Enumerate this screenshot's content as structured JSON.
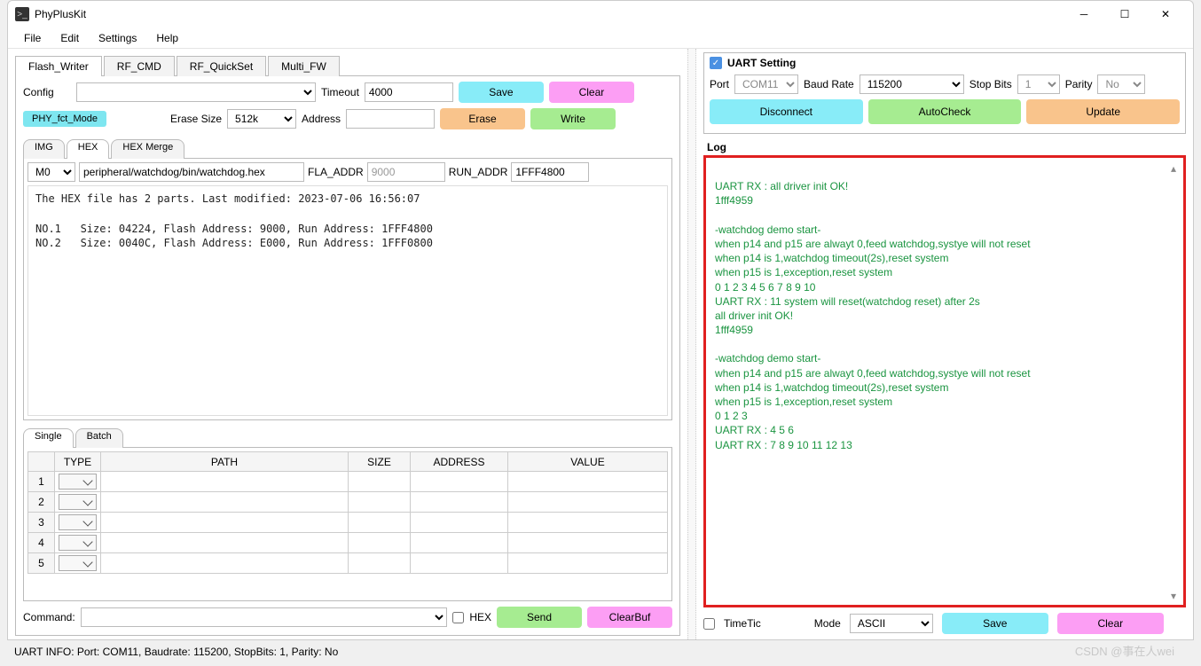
{
  "title": "PhyPlusKit",
  "menu": {
    "file": "File",
    "edit": "Edit",
    "settings": "Settings",
    "help": "Help"
  },
  "mainTabs": {
    "flash": "Flash_Writer",
    "rf": "RF_CMD",
    "rfq": "RF_QuickSet",
    "multi": "Multi_FW"
  },
  "config": {
    "label": "Config",
    "timeout_label": "Timeout",
    "timeout": "4000",
    "save": "Save",
    "clear": "Clear"
  },
  "phymode": "PHY_fct_Mode",
  "erase": {
    "label": "Erase Size",
    "value": "512k",
    "addr_label": "Address",
    "erase": "Erase",
    "write": "Write"
  },
  "subTabs": {
    "img": "IMG",
    "hex": "HEX",
    "merge": "HEX Merge"
  },
  "hex": {
    "m": "M0",
    "path": "peripheral/watchdog/bin/watchdog.hex",
    "fla_label": "FLA_ADDR",
    "fla": "9000",
    "run_label": "RUN_ADDR",
    "run": "1FFF4800",
    "info": "The HEX file has 2 parts. Last modified: 2023-07-06 16:56:07\n\nNO.1   Size: 04224, Flash Address: 9000, Run Address: 1FFF4800\nNO.2   Size: 0040C, Flash Address: E000, Run Address: 1FFF0800"
  },
  "sb": {
    "single": "Single",
    "batch": "Batch"
  },
  "table": {
    "h": [
      "",
      "TYPE",
      "PATH",
      "SIZE",
      "ADDRESS",
      "VALUE"
    ],
    "rows": [
      "1",
      "2",
      "3",
      "4",
      "5"
    ]
  },
  "cmd": {
    "label": "Command:",
    "hexlbl": "HEX",
    "send": "Send",
    "clear": "ClearBuf"
  },
  "uart": {
    "title": "UART Setting",
    "port_l": "Port",
    "port": "COM11",
    "baud_l": "Baud Rate",
    "baud": "115200",
    "stop_l": "Stop Bits",
    "stop": "1",
    "par_l": "Parity",
    "par": "No",
    "disc": "Disconnect",
    "auto": "AutoCheck",
    "upd": "Update"
  },
  "log": {
    "title": "Log",
    "text": "\nUART RX : all driver init OK!\n1fff4959\n\n-watchdog demo start-\nwhen p14 and p15 are alwayt 0,feed watchdog,systye will not reset\nwhen p14 is 1,watchdog timeout(2s),reset system\nwhen p15 is 1,exception,reset system\n0 1 2 3 4 5 6 7 8 9 10 \nUART RX : 11 system will reset(watchdog reset) after 2s\nall driver init OK!\n1fff4959\n\n-watchdog demo start-\nwhen p14 and p15 are alwayt 0,feed watchdog,systye will not reset\nwhen p14 is 1,watchdog timeout(2s),reset system\nwhen p15 is 1,exception,reset system\n0 1 2 3 \nUART RX : 4 5 6 \nUART RX : 7 8 9 10 11 12 13 "
  },
  "rbottom": {
    "tt": "TimeTic",
    "mode_l": "Mode",
    "mode": "ASCII",
    "save": "Save",
    "clear": "Clear"
  },
  "status": "UART INFO:  Port: COM11, Baudrate: 115200, StopBits: 1, Parity: No",
  "watermark": "CSDN @事在人wei"
}
